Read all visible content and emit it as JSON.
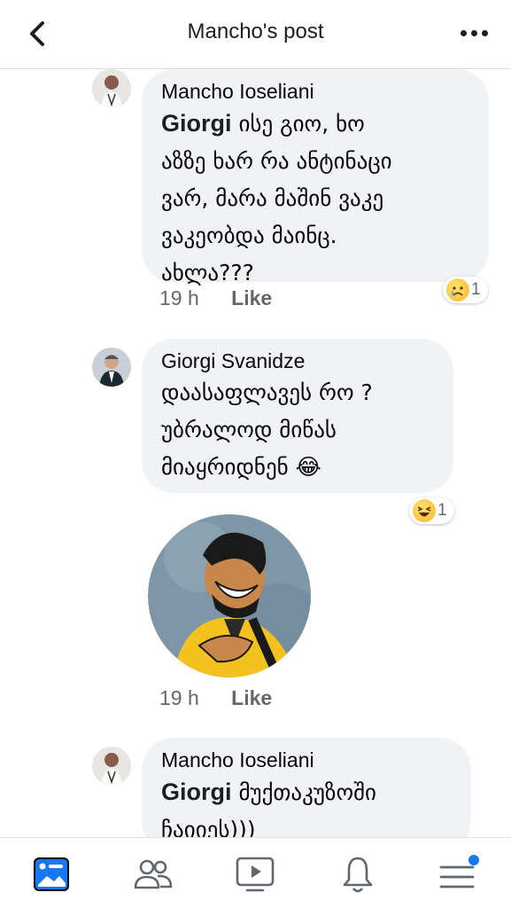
{
  "header": {
    "title": "Mancho's post"
  },
  "comments": [
    {
      "author": "Mancho Ioseliani",
      "mention": "Giorgi",
      "lines": [
        "ისე გიო, ხო",
        "აზზე ხარ რა ანტინაცი",
        "ვარ, მარა მაშინ ვაკე",
        "ვაკეობდა მაინც.",
        "ახლა???"
      ],
      "time": "19 h",
      "like": "Like",
      "reaction_emoji": "crying-face",
      "reaction_count": "1"
    },
    {
      "author": "Giorgi Svanidze",
      "lines": [
        "დაასაფლავეს რო ?",
        "უბრალოდ მიწას",
        "მიაყრიდნენ 😂"
      ],
      "reaction_emoji": "laughing-face",
      "reaction_count": "1",
      "time": "19 h",
      "like": "Like"
    },
    {
      "author": "Mancho Ioseliani",
      "mention": "Giorgi",
      "lines": [
        "მუქთაკუზოში",
        "ჩაიიეს)))"
      ]
    }
  ],
  "bottom_nav": {
    "items": [
      "news-feed",
      "friends",
      "watch",
      "notifications",
      "menu"
    ],
    "active": "news-feed",
    "accent": "#1877f2"
  }
}
